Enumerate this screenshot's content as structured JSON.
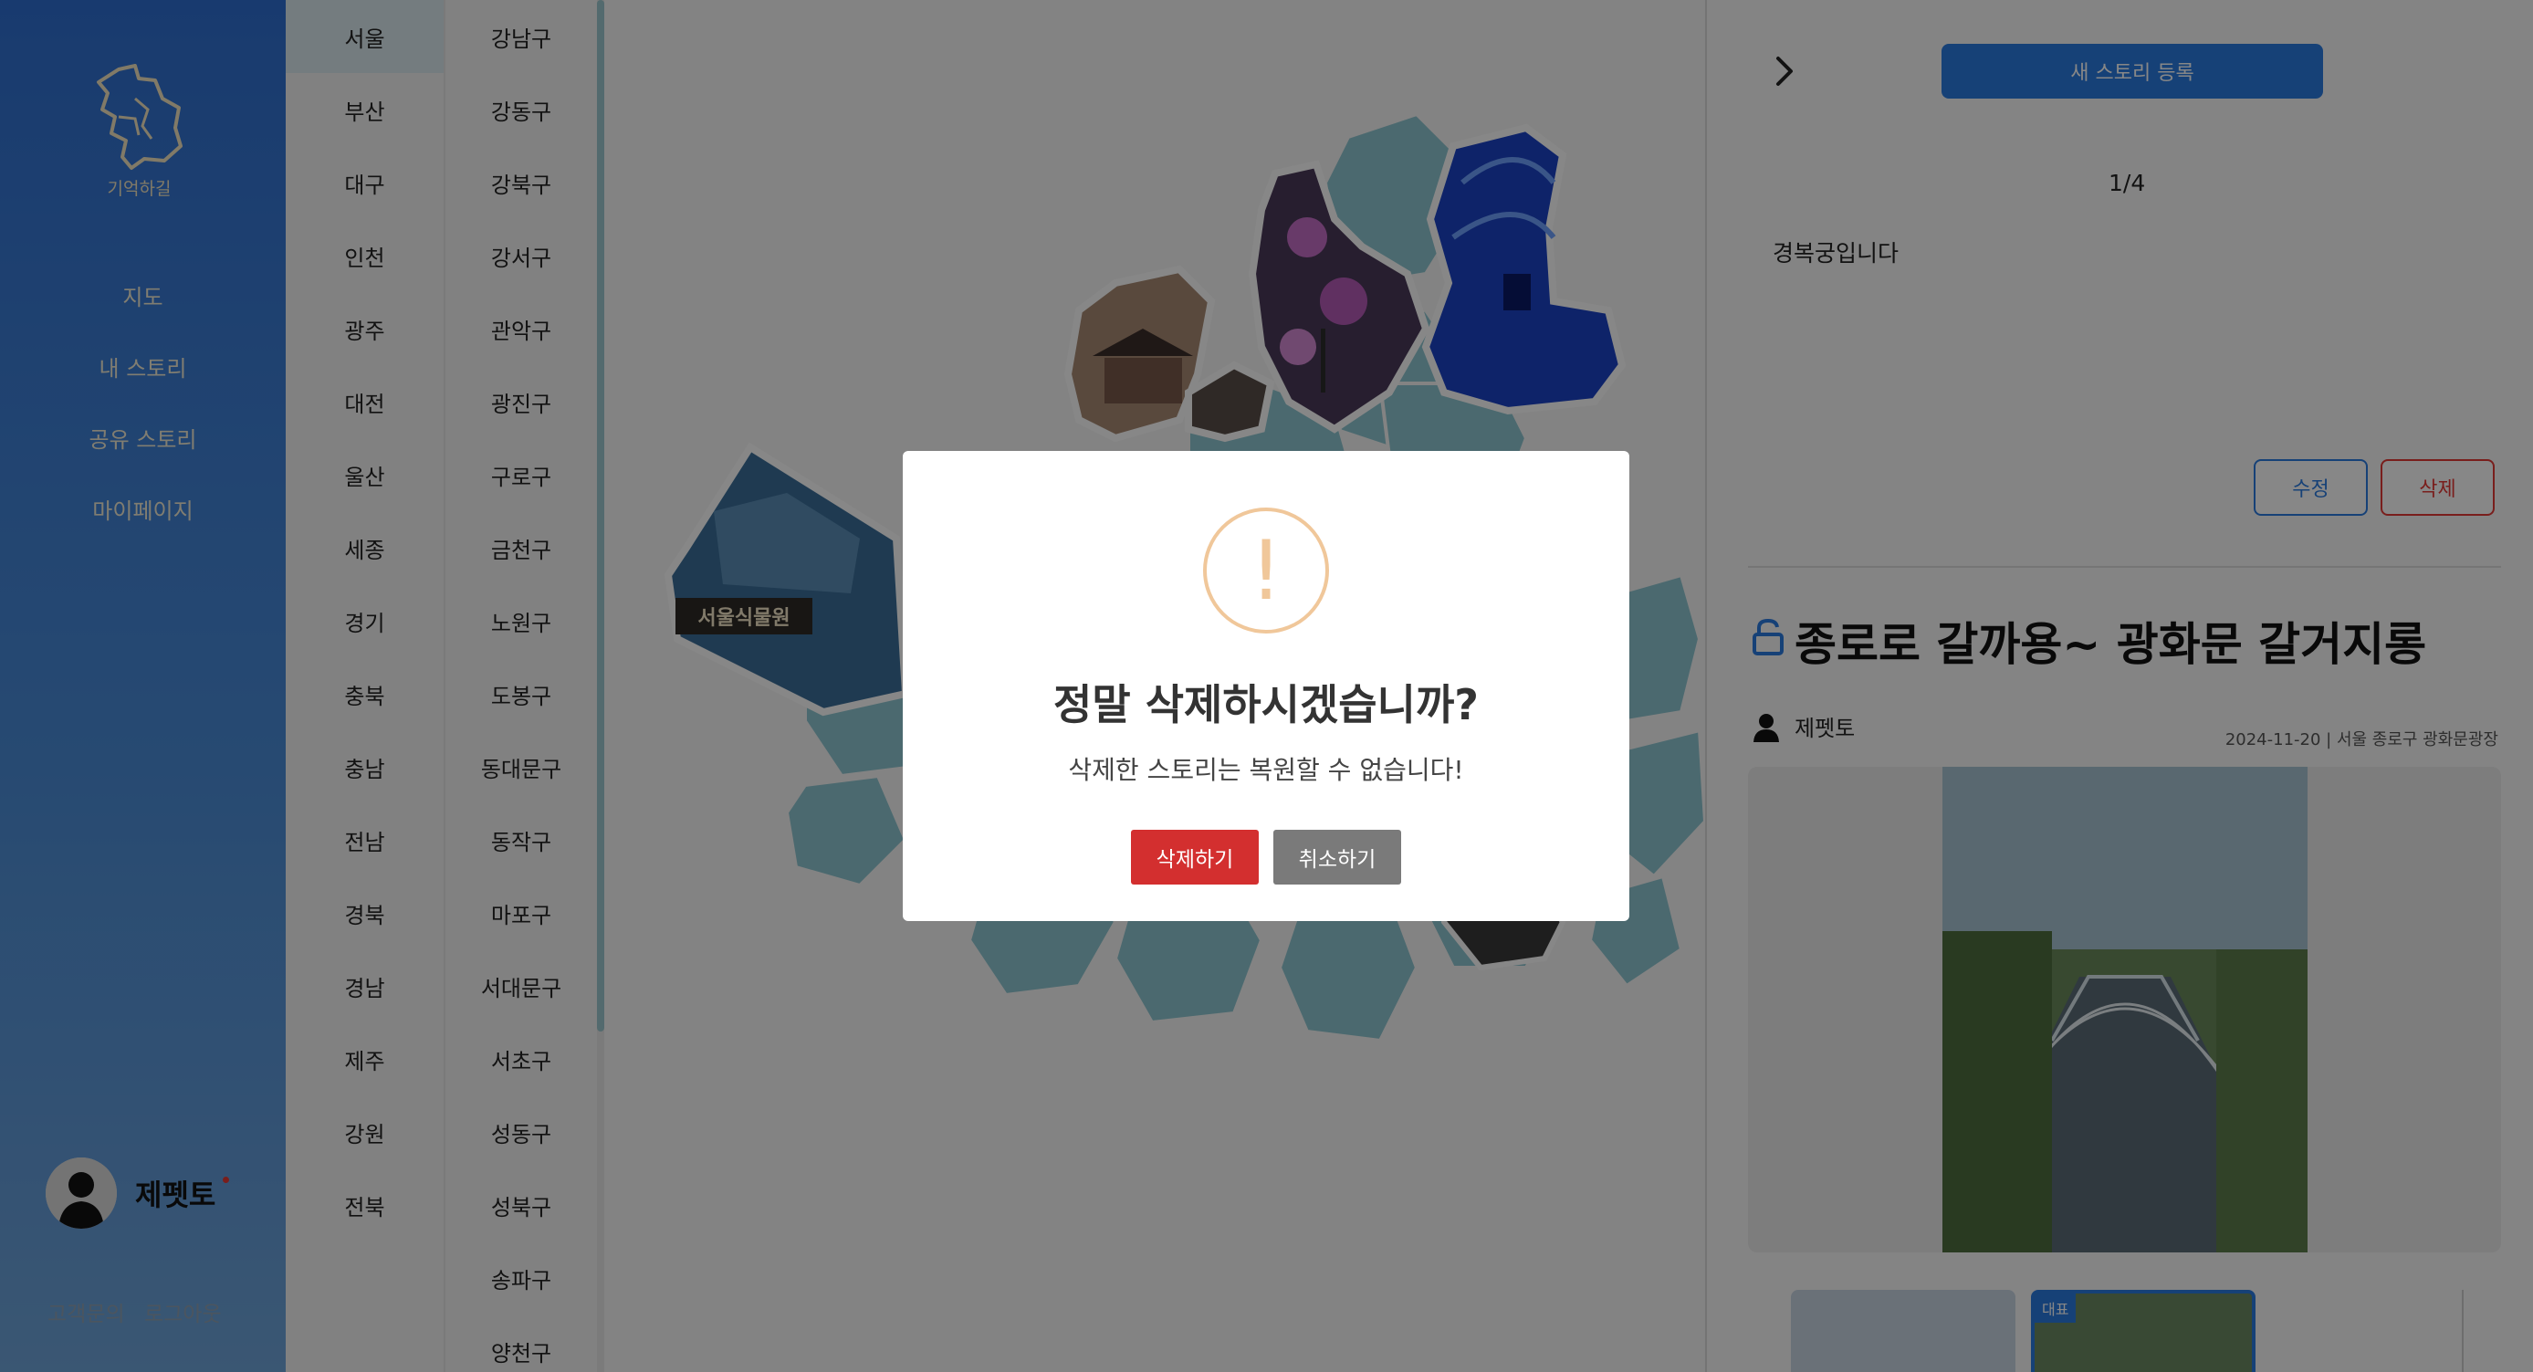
{
  "sidebar": {
    "logo_text": "기억하길",
    "nav": [
      {
        "label": "지도"
      },
      {
        "label": "내 스토리"
      },
      {
        "label": "공유 스토리"
      },
      {
        "label": "마이페이지"
      }
    ],
    "profile_name": "제펫토",
    "footer": {
      "support": "고객문의",
      "logout": "로그아웃"
    }
  },
  "regions": {
    "cities": [
      "서울",
      "부산",
      "대구",
      "인천",
      "광주",
      "대전",
      "울산",
      "세종",
      "경기",
      "충북",
      "충남",
      "전남",
      "경북",
      "경남",
      "제주",
      "강원",
      "전북"
    ],
    "selected_city": "서울",
    "districts": [
      "강남구",
      "강동구",
      "강북구",
      "강서구",
      "관악구",
      "광진구",
      "구로구",
      "금천구",
      "노원구",
      "도봉구",
      "동대문구",
      "동작구",
      "마포구",
      "서대문구",
      "서초구",
      "성동구",
      "성북구",
      "송파구",
      "양천구"
    ]
  },
  "map": {
    "sticker_label": "서울식물원"
  },
  "panel": {
    "new_story_label": "새 스토리 등록",
    "page_indicator": "1/4",
    "story_text": "경복궁입니다",
    "edit_label": "수정",
    "delete_label": "삭제",
    "title": "종로로 갈까용~ 광화문 갈거지롱",
    "author": "제펫토",
    "meta": "2024-11-20 | 서울 종로구 광화문광장",
    "thumb_badge": "대표"
  },
  "modal": {
    "icon": "!",
    "title": "정말 삭제하시겠습니까?",
    "message": "삭제한 스토리는 복원할 수 없습니다!",
    "confirm_label": "삭제하기",
    "cancel_label": "취소하기"
  },
  "colors": {
    "sidebar_top": "#2f6fd1",
    "accent_blue": "#2b7be0",
    "danger_red": "#d32f2f",
    "map_fill": "#8ec7d1",
    "warning": "#f0c79a"
  }
}
